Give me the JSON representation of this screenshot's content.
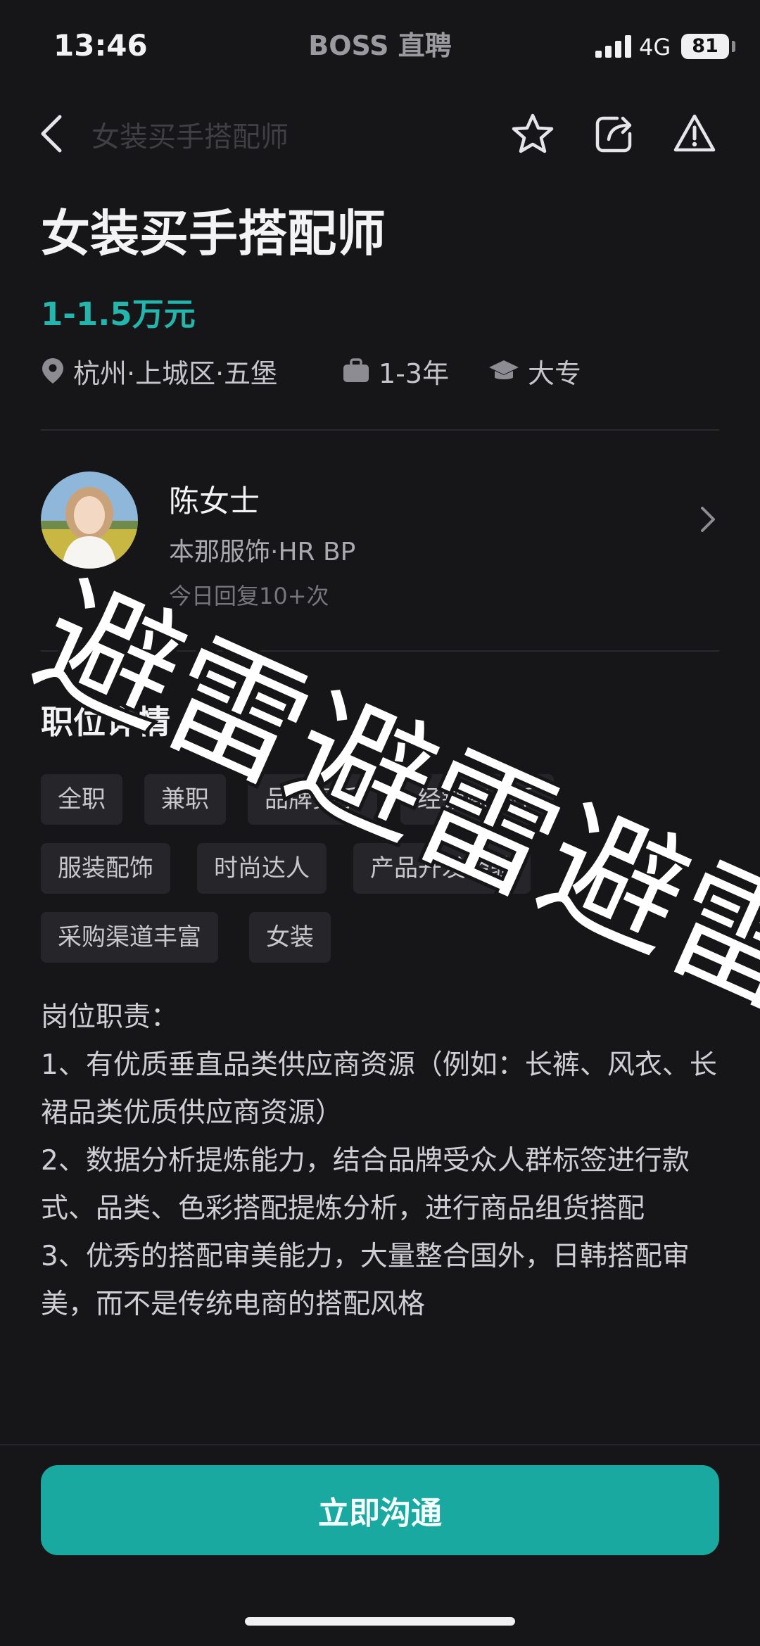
{
  "status": {
    "time": "13:46",
    "app_name": "BOSS 直聘",
    "network": "4G",
    "battery": "81"
  },
  "nav": {
    "title": "女装买手搭配师"
  },
  "job": {
    "title": "女装买手搭配师",
    "salary": "1-1.5万元",
    "location": "杭州·上城区·五堡",
    "experience": "1-3年",
    "education": "大专"
  },
  "recruiter": {
    "name": "陈女士",
    "company": "本那服饰·HR BP",
    "reply": "今日回复10+次"
  },
  "details": {
    "title": "职位详情",
    "tags": [
      "全职",
      "兼职",
      "品牌买手",
      "经销商买手",
      "服装配饰",
      "时尚达人",
      "产品开发经验",
      "采购渠道丰富",
      "女装"
    ],
    "description": [
      "岗位职责：",
      "1、有优质垂直品类供应商资源（例如：长裤、风衣、长裙品类优质供应商资源）",
      "2、数据分析提炼能力，结合品牌受众人群标签进行款式、品类、色彩搭配提炼分析，进行商品组货搭配",
      "3、优秀的搭配审美能力，大量整合国外，日韩搭配审美，而不是传统电商的搭配风格"
    ]
  },
  "cta": {
    "label": "立即沟通"
  },
  "overlay": {
    "text": "避雷避雷避雷"
  },
  "colors": {
    "background": "#161618",
    "accent": "#1aa9a0",
    "salary": "#24b5ac"
  }
}
